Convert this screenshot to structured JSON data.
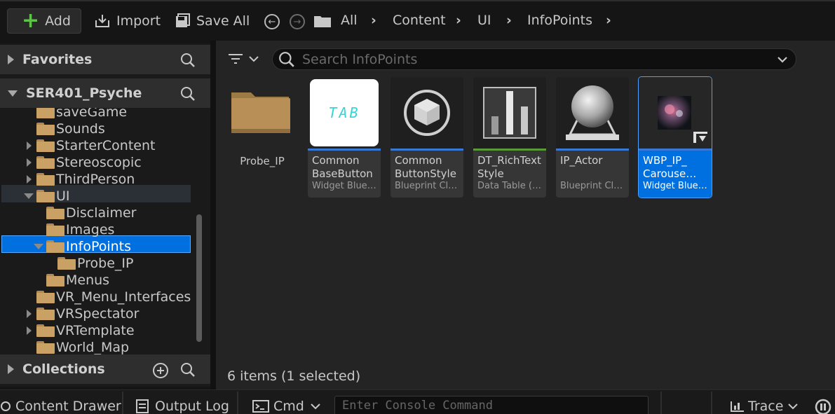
{
  "toolbar": {
    "add_label": "Add",
    "import_label": "Import",
    "save_all_label": "Save All",
    "breadcrumbs": [
      "All",
      "Content",
      "UI",
      "InfoPoints"
    ]
  },
  "left_panel": {
    "favorites_label": "Favorites",
    "project_label": "SER401_Psyche",
    "collections_label": "Collections",
    "tree": [
      {
        "label": "saveGame",
        "indent": 1,
        "expander": "none"
      },
      {
        "label": "Sounds",
        "indent": 1,
        "expander": "none"
      },
      {
        "label": "StarterContent",
        "indent": 1,
        "expander": "collapsed"
      },
      {
        "label": "Stereoscopic",
        "indent": 1,
        "expander": "collapsed"
      },
      {
        "label": "ThirdPerson",
        "indent": 1,
        "expander": "collapsed"
      },
      {
        "label": "UI",
        "indent": 1,
        "expander": "expanded"
      },
      {
        "label": "Disclaimer",
        "indent": 2,
        "expander": "none"
      },
      {
        "label": "Images",
        "indent": 2,
        "expander": "none"
      },
      {
        "label": "InfoPoints",
        "indent": 2,
        "expander": "expanded"
      },
      {
        "label": "Probe_IP",
        "indent": 3,
        "expander": "none"
      },
      {
        "label": "Menus",
        "indent": 2,
        "expander": "none"
      },
      {
        "label": "VR_Menu_Interfaces",
        "indent": 1,
        "expander": "none"
      },
      {
        "label": "VRSpectator",
        "indent": 1,
        "expander": "collapsed"
      },
      {
        "label": "VRTemplate",
        "indent": 1,
        "expander": "collapsed"
      },
      {
        "label": "World_Map",
        "indent": 1,
        "expander": "none"
      }
    ]
  },
  "content": {
    "search_placeholder": "Search InfoPoints",
    "folder": {
      "label": "Probe_IP"
    },
    "assets": [
      {
        "name": "Common\nBaseButton",
        "type": "Widget Bluep…",
        "thumb": "TAB",
        "bar_color": "#3a78d8"
      },
      {
        "name": "Common\nButtonStyle",
        "type": "Blueprint Class",
        "thumb": "",
        "bar_color": "#3a78d8"
      },
      {
        "name": "DT_RichText\nStyle",
        "type": "Data Table (R…",
        "thumb": "",
        "bar_color": "#5a9a3a"
      },
      {
        "name": "IP_Actor",
        "type": "Blueprint Class",
        "thumb": "",
        "bar_color": "#3a78d8"
      },
      {
        "name": "WBP_IP_\nCarouse…",
        "type": "Widget Bluep…",
        "thumb": "",
        "bar_color": "#3a78d8"
      }
    ],
    "status": "6 items (1 selected)"
  },
  "bottom_bar": {
    "content_drawer_label": "Content Drawer",
    "output_log_label": "Output Log",
    "cmd_label": "Cmd",
    "console_placeholder": "Enter Console Command",
    "trace_label": "Trace"
  },
  "colors": {
    "selection": "#0070e0",
    "add_icon": "#5fc34a",
    "folder": "#c9a165"
  }
}
